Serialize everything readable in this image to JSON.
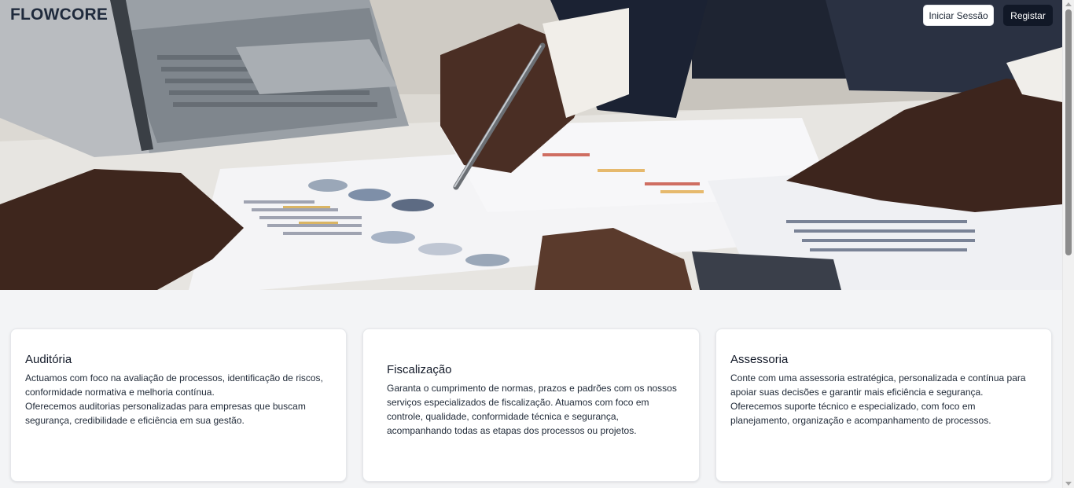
{
  "header": {
    "logo": "FLOWCORE",
    "login_label": "Iniciar Sessão",
    "register_label": "Registar"
  },
  "hero": {
    "image_alt": "business-meeting-charts-photo",
    "colors": {
      "accent_dark": "#111827",
      "logo": "#1f2a3c",
      "background": "#f3f4f6"
    }
  },
  "services": [
    {
      "title": "Auditória",
      "text_line_1": "Actuamos com foco na avaliação de processos, identificação de riscos, conformidade normativa e melhoria contínua.",
      "text_line_2": "Oferecemos auditorias personalizadas para empresas que buscam segurança, credibilidade e eficiência em sua gestão."
    },
    {
      "title": "Fiscalização",
      "text_line_1": "Garanta o cumprimento de normas, prazos e padrões com os nossos serviços especializados de fiscalização. Atuamos com foco em controle, qualidade, conformidade técnica e segurança, acompanhando todas as etapas dos processos ou projetos."
    },
    {
      "title": "Assessoria",
      "text_line_1": "Conte com uma assessoria estratégica, personalizada e contínua para apoiar suas decisões e garantir mais eficiência e segurança.",
      "text_line_2": "Oferecemos suporte técnico e especializado, com foco em planejamento, organização e acompanhamento de processos."
    }
  ]
}
